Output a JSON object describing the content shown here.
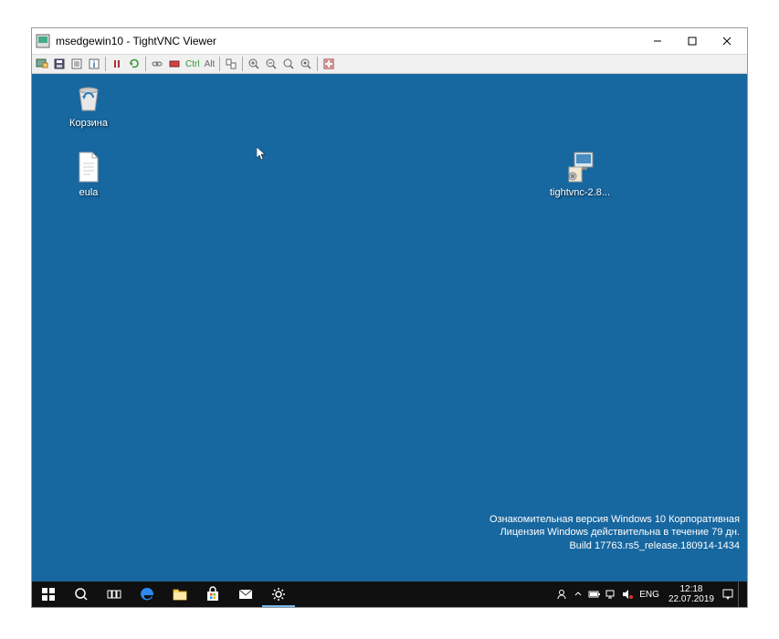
{
  "window": {
    "title": "msedgewin10 - TightVNC Viewer"
  },
  "toolbar": {
    "ctrl_label": "Ctrl",
    "alt_label": "Alt"
  },
  "desktop": {
    "icons": {
      "recycle_bin": {
        "label": "Корзина"
      },
      "eula": {
        "label": "eula"
      },
      "tightvnc": {
        "label": "tightvnc-2.8..."
      }
    },
    "watermark": {
      "line1": "Ознакомительная версия Windows 10 Корпоративная",
      "line2": "Лицензия Windows действительна в течение 79 дн.",
      "line3": "Build 17763.rs5_release.180914-1434"
    }
  },
  "taskbar": {
    "lang": "ENG",
    "time": "12:18",
    "date": "22.07.2019"
  }
}
